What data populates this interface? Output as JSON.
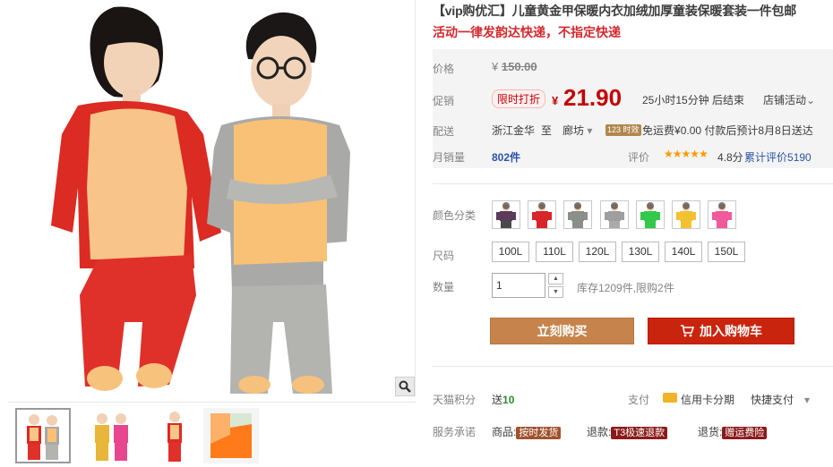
{
  "product": {
    "title": "【vip购优汇】儿童黄金甲保暖内衣加绒加厚童装保暖套装一件包邮",
    "subtitle": "活动一律发韵达快递，不指定快递"
  },
  "price": {
    "label": "价格",
    "currency": "¥",
    "original": "150.00"
  },
  "promo": {
    "label": "促销",
    "tag": "限时打折",
    "currency": "¥",
    "price": "21.90",
    "countdown": "25小时15分钟 后结束",
    "shop_promo": "店铺活动",
    "shop_promo_arrow": "⌄"
  },
  "shipping": {
    "label": "配送",
    "from": "浙江金华",
    "to_word": "至",
    "to": "廊坊",
    "dropdown_icon": "▾",
    "badge": "123 时效",
    "free_freight": "免运费",
    "freight_value": "¥0.00",
    "estimate": "付款后预计8月8日送达"
  },
  "sales": {
    "label": "月销量",
    "count": "802",
    "unit": "件",
    "rating_label": "评价",
    "stars": "★★★★★",
    "score": "4.8分",
    "review_label": "累计评价",
    "review_count": "5190"
  },
  "color": {
    "label": "颜色分类",
    "swatches": [
      {
        "shirt": "#5c3a5a",
        "pants": "#4a4a4a"
      },
      {
        "shirt": "#d8252a",
        "pants": "#d8252a"
      },
      {
        "shirt": "#8a8f8a",
        "pants": "#8a8f8a"
      },
      {
        "shirt": "#9e9e9e",
        "pants": "#aaaaaa"
      },
      {
        "shirt": "#32c94a",
        "pants": "#32c94a"
      },
      {
        "shirt": "#f2c231",
        "pants": "#f2c231"
      },
      {
        "shirt": "#f05a9a",
        "pants": "#f05a9a"
      }
    ]
  },
  "size": {
    "label": "尺码",
    "options": [
      "100L",
      "110L",
      "120L",
      "130L",
      "140L",
      "150L"
    ]
  },
  "quantity": {
    "label": "数量",
    "value": "1",
    "up_icon": "▲",
    "down_icon": "▼",
    "stock": "库存1209件,限购2件"
  },
  "actions": {
    "buy_now": "立刻购买",
    "add_to_cart": "加入购物车",
    "cart_icon": "cart-icon"
  },
  "points": {
    "label": "天猫积分",
    "prefix": "送",
    "value": "10"
  },
  "payment": {
    "label": "支付",
    "card": "信用卡分期",
    "quick": "快捷支付",
    "dropdown_icon": "▾"
  },
  "services": {
    "label": "服务承诺",
    "items": [
      {
        "name": "商品:",
        "tag": "按时发货",
        "color": "#a0522d"
      },
      {
        "name": "退款:",
        "tag": "T3极速退款",
        "color": "#8b1a1a"
      },
      {
        "name": "退货:",
        "tag": "赠运费险",
        "color": "#8b1a1a"
      }
    ]
  },
  "colors": {
    "accent_red": "#c40000",
    "buy_now_bg": "#c6844c",
    "cart_bg": "#c9240d",
    "link_blue": "#2953a6"
  }
}
